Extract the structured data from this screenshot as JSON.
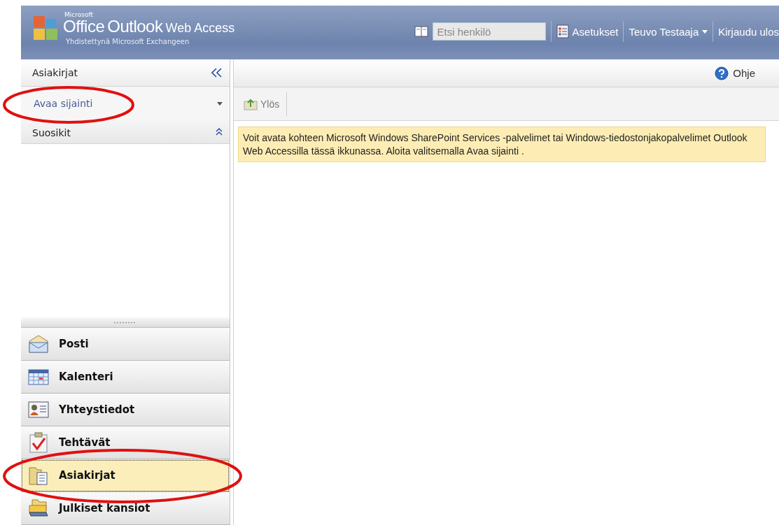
{
  "header": {
    "logo_small": "Microsoft",
    "logo_office": "Office",
    "logo_outlook": "Outlook",
    "logo_web": "Web Access",
    "subtitle": "Yhdistettynä Microsoft Exchangeen",
    "search": {
      "placeholder": "Etsi henkilö"
    },
    "options": "Asetukset",
    "user": "Teuvo Testaaja",
    "logout": "Kirjaudu ulos"
  },
  "sidebar": {
    "title": "Asiakirjat",
    "open_location": "Avaa sijainti",
    "favorites": "Suosikit",
    "nav": [
      {
        "label": "Posti",
        "kind": "mail",
        "selected": false
      },
      {
        "label": "Kalenteri",
        "kind": "calendar",
        "selected": false
      },
      {
        "label": "Yhteystiedot",
        "kind": "contacts",
        "selected": false
      },
      {
        "label": "Tehtävät",
        "kind": "tasks",
        "selected": false
      },
      {
        "label": "Asiakirjat",
        "kind": "documents",
        "selected": true
      },
      {
        "label": "Julkiset kansiot",
        "kind": "public-folders",
        "selected": false
      }
    ]
  },
  "main": {
    "help": "Ohje",
    "up": "Ylös",
    "message": "Voit avata kohteen Microsoft Windows SharePoint Services -palvelimet tai Windows-tiedostonjakopalvelimet Outlook Web Accessilla tässä ikkunassa. Aloita valitsemalla Avaa sijainti ."
  }
}
